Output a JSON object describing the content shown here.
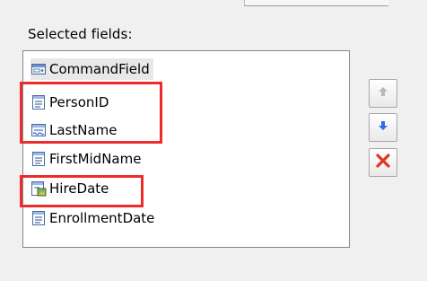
{
  "section": {
    "label": "Selected fields:"
  },
  "fields_list": {
    "items": [
      {
        "label": "CommandField",
        "icon": "command-field-icon",
        "state": "highlighted"
      },
      {
        "label": "PersonID",
        "icon": "bound-field-icon",
        "state": "normal"
      },
      {
        "label": "LastName",
        "icon": "hyperlink-field-icon",
        "state": "normal"
      },
      {
        "label": "FirstMidName",
        "icon": "bound-field-icon",
        "state": "normal"
      },
      {
        "label": "HireDate",
        "icon": "image-field-icon",
        "state": "normal"
      },
      {
        "label": "EnrollmentDate",
        "icon": "bound-field-icon",
        "state": "normal"
      }
    ]
  },
  "buttons": {
    "move_up": {
      "icon": "arrow-up-icon",
      "state": "disabled"
    },
    "move_down": {
      "icon": "arrow-down-icon",
      "state": "enabled"
    },
    "remove": {
      "icon": "delete-x-icon",
      "state": "enabled"
    }
  },
  "colors": {
    "annotation": "#ee2b2b",
    "arrow_enabled": "#2f6fe4",
    "arrow_disabled": "#b8b8b8",
    "delete": "#e0361f",
    "panel_background": "#f0f0f0"
  }
}
